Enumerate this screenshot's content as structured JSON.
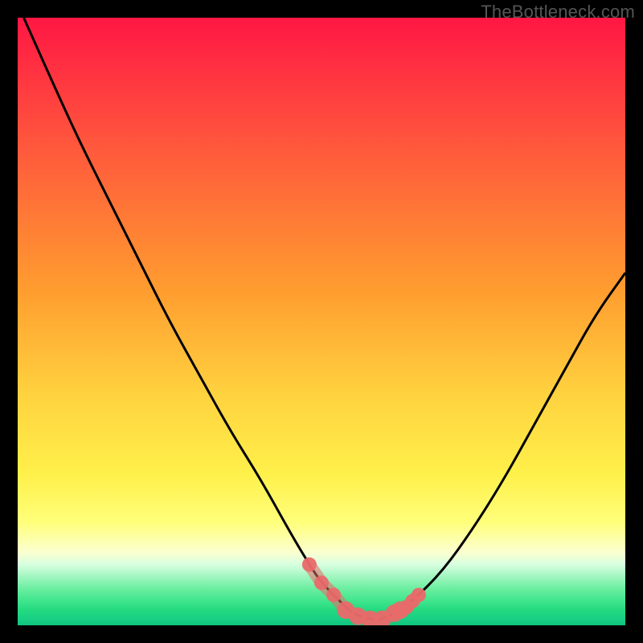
{
  "watermark": "TheBottleneck.com",
  "chart_data": {
    "type": "line",
    "title": "",
    "xlabel": "",
    "ylabel": "",
    "xlim": [
      0,
      100
    ],
    "ylim": [
      0,
      100
    ],
    "grid": false,
    "legend": false,
    "series": [
      {
        "name": "bottleneck-curve",
        "x": [
          1,
          5,
          10,
          15,
          20,
          25,
          30,
          35,
          40,
          45,
          48,
          50,
          53,
          55,
          58,
          60,
          62,
          65,
          70,
          75,
          80,
          85,
          90,
          95,
          100
        ],
        "y": [
          100,
          91,
          80,
          70,
          60,
          50,
          41,
          32,
          24,
          15,
          10,
          7,
          4,
          2,
          1,
          1,
          2,
          4,
          9,
          16,
          24,
          33,
          42,
          51,
          58
        ]
      }
    ],
    "markers": {
      "name": "highlight-points",
      "x": [
        48,
        50,
        52,
        54,
        56,
        58,
        60,
        62,
        63,
        64,
        65,
        66
      ],
      "y": [
        10,
        7,
        5,
        2.5,
        1.5,
        1,
        1,
        2,
        2.5,
        3,
        4,
        5
      ]
    },
    "background_gradient_stops": [
      {
        "offset": 0,
        "color": "#ff1744"
      },
      {
        "offset": 22,
        "color": "#ff5a3c"
      },
      {
        "offset": 45,
        "color": "#ff9d2f"
      },
      {
        "offset": 62,
        "color": "#ffd23f"
      },
      {
        "offset": 75,
        "color": "#fff04a"
      },
      {
        "offset": 83,
        "color": "#ffff7a"
      },
      {
        "offset": 88,
        "color": "#fbffd0"
      },
      {
        "offset": 90,
        "color": "#d7ffe0"
      },
      {
        "offset": 92,
        "color": "#a0f6bf"
      },
      {
        "offset": 94,
        "color": "#6aeea0"
      },
      {
        "offset": 96,
        "color": "#3fe58c"
      },
      {
        "offset": 97.5,
        "color": "#23da80"
      },
      {
        "offset": 99,
        "color": "#18cf85"
      },
      {
        "offset": 100,
        "color": "#0fc57c"
      }
    ],
    "marker_color": "#e86a6a",
    "curve_color": "#000000"
  }
}
